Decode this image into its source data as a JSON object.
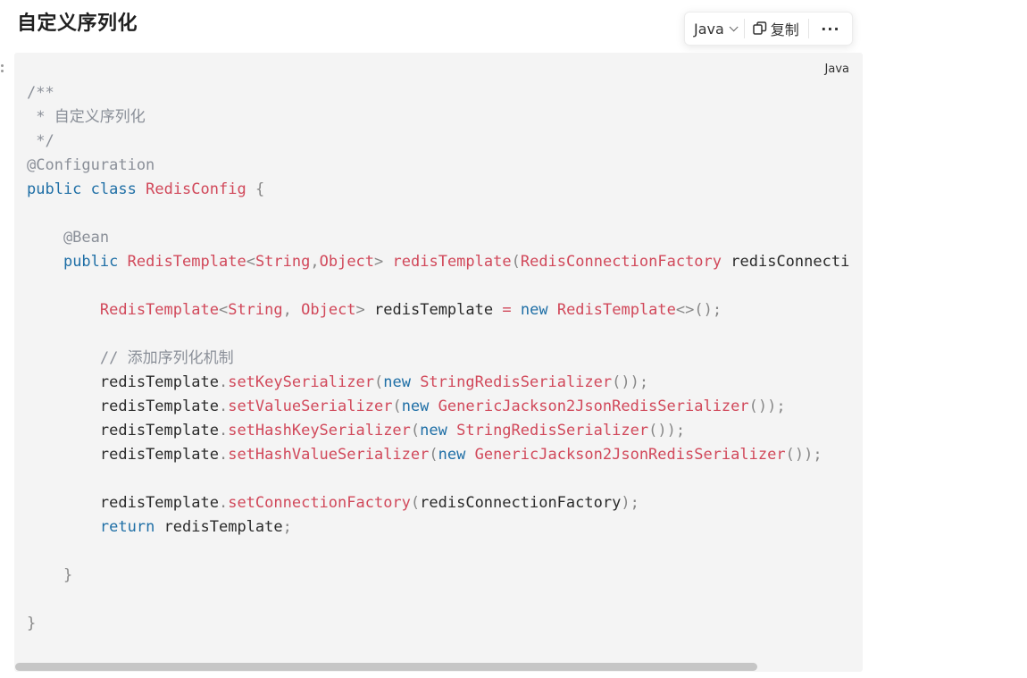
{
  "heading": "自定义序列化",
  "toolbar": {
    "language": "Java",
    "copy_label": "复制",
    "more_label": "···"
  },
  "code_block": {
    "language_label": "Java",
    "lines": [
      "/**",
      " * 自定义序列化",
      " */",
      "@Configuration",
      "public class RedisConfig {",
      "",
      "    @Bean",
      "    public RedisTemplate<String,Object> redisTemplate(RedisConnectionFactory redisConnecti",
      "",
      "        RedisTemplate<String, Object> redisTemplate = new RedisTemplate<>();",
      "",
      "        // 添加序列化机制",
      "        redisTemplate.setKeySerializer(new StringRedisSerializer());",
      "        redisTemplate.setValueSerializer(new GenericJackson2JsonRedisSerializer());",
      "        redisTemplate.setHashKeySerializer(new StringRedisSerializer());",
      "        redisTemplate.setHashValueSerializer(new GenericJackson2JsonRedisSerializer());",
      "",
      "        redisTemplate.setConnectionFactory(redisConnectionFactory);",
      "        return redisTemplate;",
      "",
      "    }",
      "",
      "}"
    ]
  },
  "colors": {
    "code_background": "#f4f4f4",
    "keyword": "#1f6fa6",
    "type_and_method": "#d1485a",
    "comment": "#8a8f98"
  }
}
